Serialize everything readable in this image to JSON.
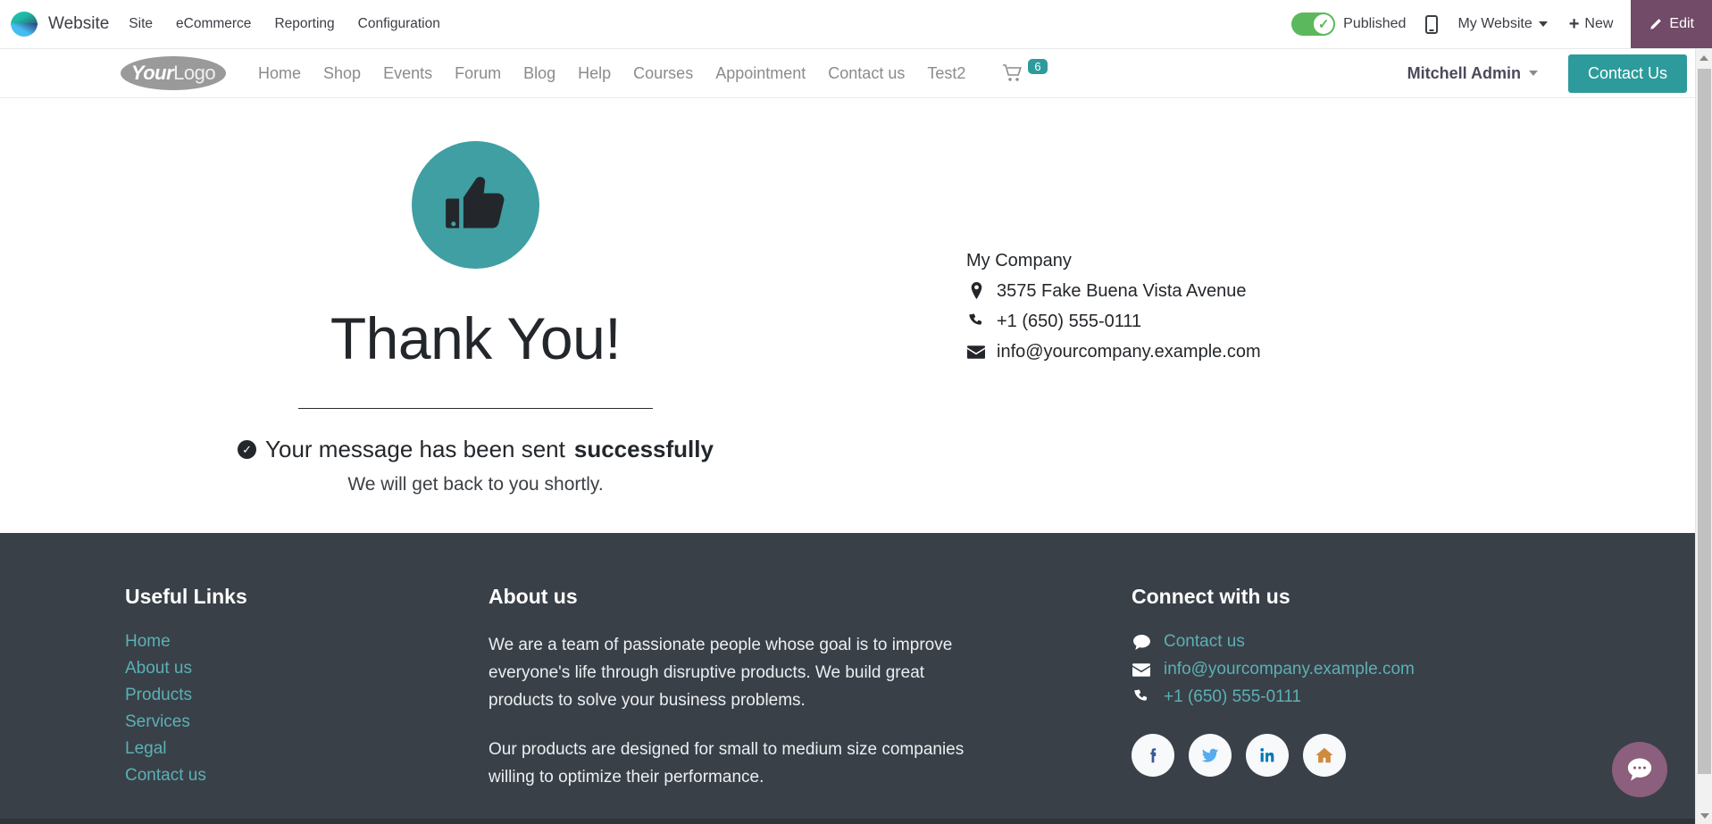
{
  "admin_bar": {
    "app_name": "Website",
    "menus": [
      "Site",
      "eCommerce",
      "Reporting",
      "Configuration"
    ],
    "publish_label": "Published",
    "publish_state": "published",
    "mobile_icon": "mobile-preview-icon",
    "website_selector": "My Website",
    "new_label": "New",
    "edit_label": "Edit",
    "edit_bg": "#714b67",
    "toggle_color": "#5cb85c"
  },
  "site_nav": {
    "logo_your": "Your",
    "logo_logo": "Logo",
    "links": [
      "Home",
      "Shop",
      "Events",
      "Forum",
      "Blog",
      "Help",
      "Courses",
      "Appointment",
      "Contact us",
      "Test2"
    ],
    "cart_count": "6",
    "cart_badge_color": "#2d9b9b",
    "user_name": "Mitchell Admin",
    "cta_label": "Contact Us",
    "cta_color": "#2d9b9b"
  },
  "main": {
    "icon": "thumbs-up-icon",
    "icon_bg": "#3f9fa3",
    "title": "Thank You!",
    "sent_prefix": "Your message has been sent",
    "sent_strong": "successfully",
    "sub_text": "We will get back to you shortly.",
    "company": {
      "name": "My Company",
      "address": "3575 Fake Buena Vista Avenue",
      "phone": "+1 (650) 555-0111",
      "email": "info@yourcompany.example.com"
    }
  },
  "footer": {
    "bg": "#3a4048",
    "useful_links": {
      "heading": "Useful Links",
      "items": [
        "Home",
        "About us",
        "Products",
        "Services",
        "Legal",
        "Contact us"
      ]
    },
    "about": {
      "heading": "About us",
      "paragraphs": [
        "We are a team of passionate people whose goal is to improve everyone's life through disruptive products. We build great products to solve your business problems.",
        "Our products are designed for small to medium size companies willing to optimize their performance."
      ]
    },
    "connect": {
      "heading": "Connect with us",
      "contact_label": "Contact us",
      "email": "info@yourcompany.example.com",
      "phone": "+1 (650) 555-0111",
      "socials": [
        "facebook-icon",
        "twitter-icon",
        "linkedin-icon",
        "home-icon"
      ],
      "link_color": "#5ab1b5"
    }
  },
  "chat": {
    "label": "livechat-bubble-icon",
    "color": "#8b5f7d"
  }
}
